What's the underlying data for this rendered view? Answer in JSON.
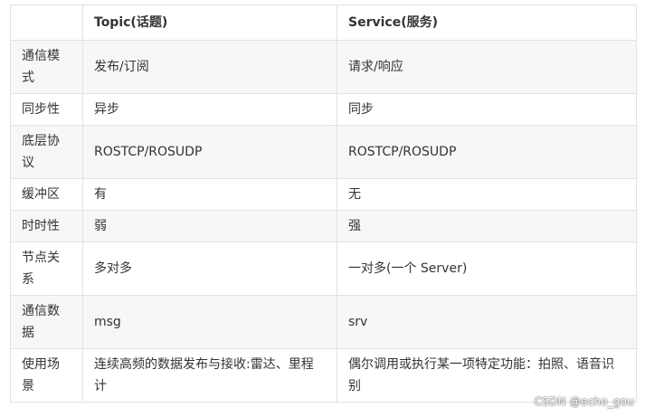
{
  "table": {
    "headers": [
      "",
      "Topic(话题)",
      "Service(服务)"
    ],
    "rows": [
      {
        "label": "通信模式",
        "topic": "发布/订阅",
        "service": "请求/响应"
      },
      {
        "label": "同步性",
        "topic": "异步",
        "service": "同步"
      },
      {
        "label": "底层协议",
        "topic": "ROSTCP/ROSUDP",
        "service": "ROSTCP/ROSUDP"
      },
      {
        "label": "缓冲区",
        "topic": "有",
        "service": "无"
      },
      {
        "label": "时时性",
        "topic": "弱",
        "service": "强"
      },
      {
        "label": "节点关系",
        "topic": "多对多",
        "service": "一对多(一个 Server)"
      },
      {
        "label": "通信数据",
        "topic": "msg",
        "service": "srv"
      },
      {
        "label": "使用场景",
        "topic": "连续高频的数据发布与接收:雷达、里程计",
        "service": "偶尔调用或执行某一项特定功能：拍照、语音识别"
      }
    ]
  },
  "watermark": "CSDN @echo_gou"
}
